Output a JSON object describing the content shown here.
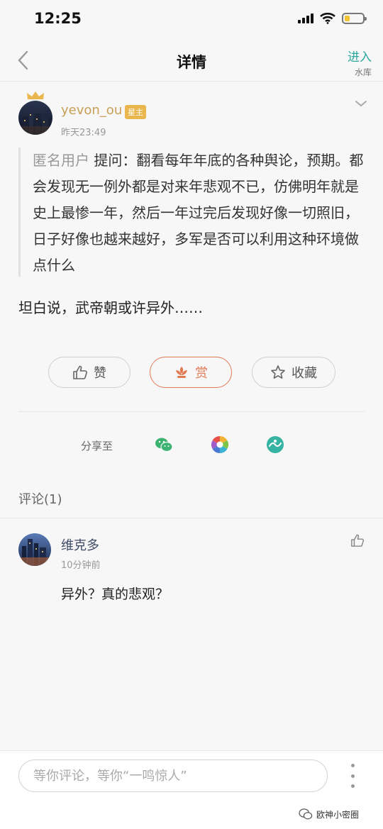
{
  "status_bar": {
    "time": "12:25"
  },
  "nav": {
    "title": "详情",
    "enter_label": "进入",
    "enter_sub": "水库"
  },
  "post": {
    "author": "yevon_ou",
    "author_badge": "星主",
    "time": "昨天23:49",
    "question_asker": "匿名用户",
    "question_text": "提问：翻看每年年底的各种舆论，预期。都会发现无一例外都是对来年悲观不已，仿佛明年就是史上最惨一年，然后一年过完后发现好像一切照旧，日子好像也越来越好，多军是否可以利用这种环境做点什么",
    "answer": "坦白说，武帝朝或许异外……"
  },
  "actions": {
    "like": "赞",
    "reward": "赏",
    "favorite": "收藏"
  },
  "share": {
    "label": "分享至"
  },
  "comments": {
    "header": "评论(1)",
    "items": [
      {
        "author": "维克多",
        "time": "10分钟前",
        "text": "异外？真的悲观？"
      }
    ]
  },
  "composer": {
    "placeholder": "等你评论，等你“一鸣惊人”"
  },
  "watermark": {
    "brand": "欧神小密圈"
  },
  "colors": {
    "accent_green": "#2aa79b",
    "author_gold": "#c89f56",
    "reward_orange": "#e27a55",
    "battery_yellow": "#f1c232"
  },
  "battery_level": 0.3
}
